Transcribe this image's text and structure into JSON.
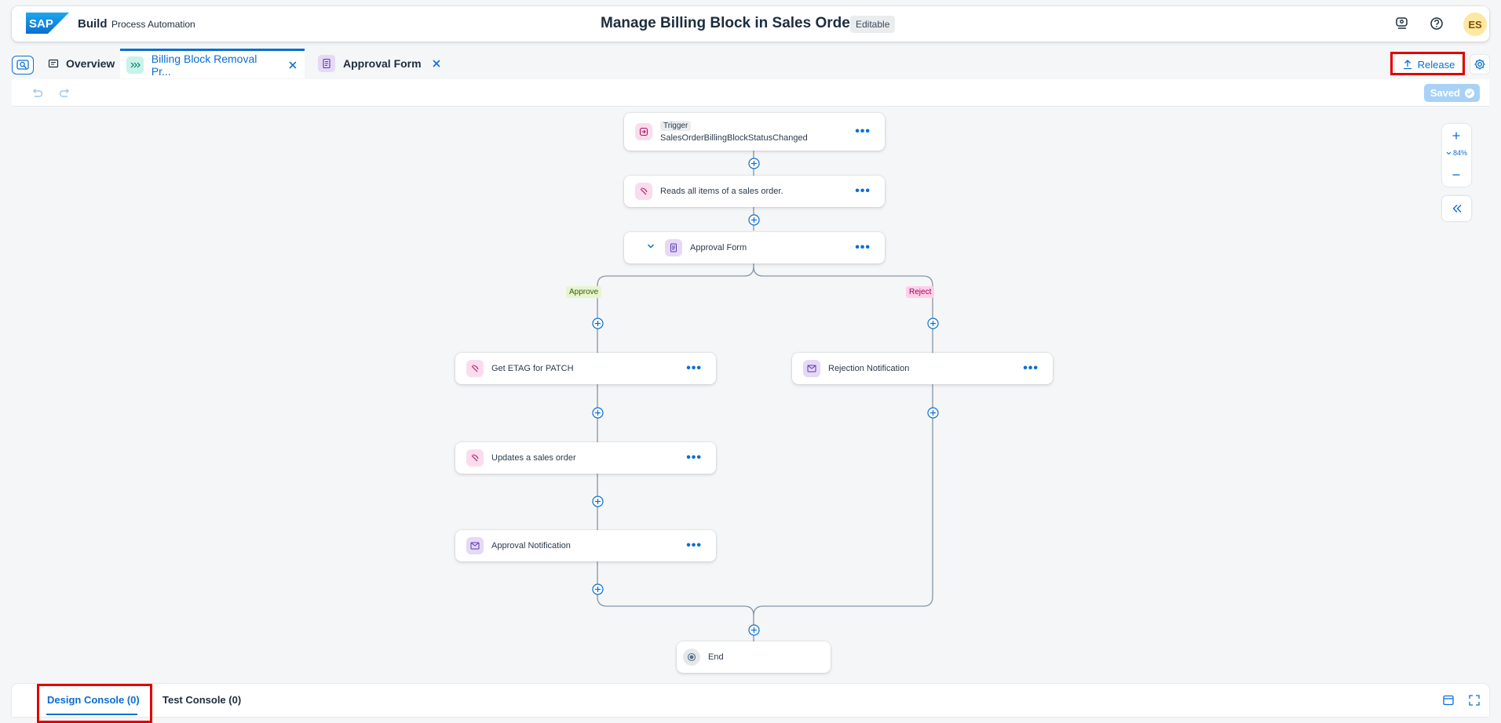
{
  "shell": {
    "brand": "Build",
    "brand_sub": "Process Automation",
    "title": "Manage Billing Block in Sales Order",
    "status_badge": "Editable",
    "avatar_initials": "ES",
    "icons": [
      "feedback-icon",
      "help-icon"
    ]
  },
  "tabs": [
    {
      "label": "Overview",
      "icon": "overview-icon",
      "active": false,
      "closable": false
    },
    {
      "label": "Billing Block Removal Pr...",
      "icon": "process-icon",
      "active": true,
      "closable": true
    },
    {
      "label": "Approval Form",
      "icon": "form-icon",
      "active": false,
      "closable": true
    }
  ],
  "toolbar": {
    "release_label": "Release",
    "saved_label": "Saved"
  },
  "canvas": {
    "zoom": "84%",
    "trigger": {
      "chip": "Trigger",
      "label": "SalesOrderBillingBlockStatusChanged"
    },
    "nodes": {
      "read_items": "Reads all items of a sales order.",
      "approval_form": "Approval Form",
      "get_etag": "Get ETAG for PATCH",
      "update_order": "Updates a sales order",
      "approval_notification": "Approval Notification",
      "rejection_notification": "Rejection Notification",
      "end": "End"
    },
    "branches": {
      "approve": "Approve",
      "reject": "Reject"
    }
  },
  "console": {
    "design_tab": "Design Console (0)",
    "test_tab": "Test Console (0)"
  },
  "colors": {
    "accent": "#0a6ed1",
    "highlight": "#e00000",
    "approve_bg": "#e6f5cf",
    "reject_bg": "#ffd0e7"
  }
}
